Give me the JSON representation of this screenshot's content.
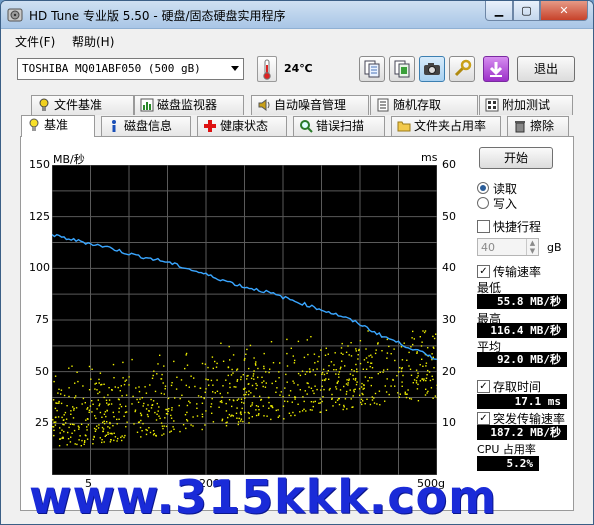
{
  "window": {
    "title": "HD Tune 专业版 5.50 - 硬盘/固态硬盘实用程序"
  },
  "menu": {
    "file": "文件(F)",
    "help": "帮助(H)"
  },
  "toolbar": {
    "drive": "TOSHIBA MQ01ABF050 (500 gB)",
    "temperature": "24℃",
    "exit_label": "退出"
  },
  "tabs_row1": [
    "文件基准",
    "磁盘监视器",
    "自动噪音管理",
    "随机存取",
    "附加测试"
  ],
  "tabs_row2": [
    "基准",
    "磁盘信息",
    "健康状态",
    "错误扫描",
    "文件夹占用率",
    "擦除"
  ],
  "selected_tab": "基准",
  "controls": {
    "start_label": "开始",
    "read_label": "读取",
    "write_label": "写入",
    "quick_label": "快捷行程",
    "quick_value": "40",
    "quick_unit": "gB",
    "transfer_label": "传输速率",
    "min_label": "最低",
    "min_value": "55.8 MB/秒",
    "max_label": "最高",
    "max_value": "116.4 MB/秒",
    "avg_label": "平均",
    "avg_value": "92.0 MB/秒",
    "access_label": "存取时间",
    "access_value": "17.1 ms",
    "burst_label": "突发传输速率",
    "burst_value": "187.2 MB/秒",
    "cpu_label": "CPU 占用率",
    "cpu_value": "5.2%"
  },
  "colors": {
    "transfer_line": "#3aa6ff",
    "access_points": "#f2f200",
    "watermark": "#1a2bd8"
  },
  "watermark": "www.315kkk.com",
  "chart_data": {
    "type": "line",
    "y_left_unit": "MB/秒",
    "y_right_unit": "ms",
    "ylim_left": [
      0,
      150
    ],
    "ylim_right": [
      0,
      60
    ],
    "yticks_left": [
      "150",
      "125",
      "100",
      "75",
      "50",
      "25"
    ],
    "yticks_right": [
      "60",
      "50",
      "40",
      "30",
      "20",
      "10"
    ],
    "xlim": [
      0,
      500
    ],
    "xticks_visible": [
      "5",
      "200",
      "500g"
    ],
    "grid": true,
    "series": [
      {
        "name": "传输速率",
        "x": [
          0,
          25,
          50,
          75,
          100,
          125,
          150,
          175,
          200,
          225,
          250,
          275,
          300,
          325,
          350,
          375,
          400,
          425,
          450,
          475,
          500
        ],
        "values": [
          116,
          114,
          112,
          110,
          107,
          105,
          103,
          100,
          97,
          94,
          91,
          89,
          86,
          83,
          80,
          77,
          73,
          68,
          64,
          60,
          56
        ]
      },
      {
        "name": "存取时间",
        "mean_ms": 17.1,
        "spread_ms": [
          5,
          28
        ]
      }
    ]
  }
}
